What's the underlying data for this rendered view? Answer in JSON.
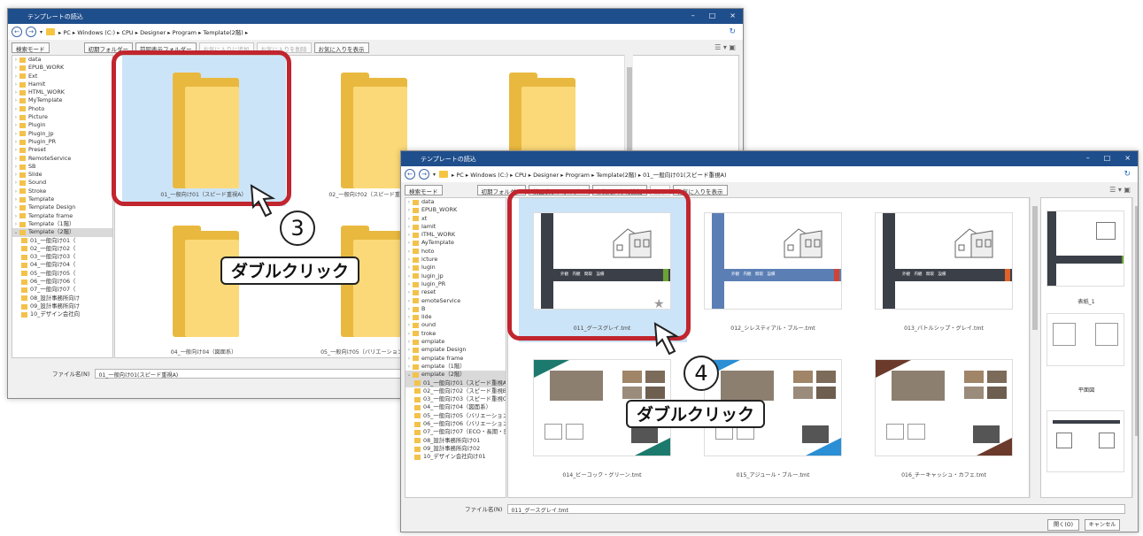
{
  "win1": {
    "title": "テンプレートの読込",
    "breadcrumb": "▸ PC ▸ Windows (C:) ▸ CPU ▸ Designer ▸ Program ▸ Template(2階) ▸",
    "toolbar": {
      "search_mode": "検索モード",
      "initial": "初期フォルダー",
      "prev": "前回表示フォルダー",
      "add_fav": "お気に入りに追加",
      "del_fav": "お気に入りを削除",
      "show_fav": "お気に入りを表示"
    },
    "tree": [
      "data",
      "EPUB_WORK",
      "Ext",
      "Hamit",
      "HTML_WORK",
      "MyTemplate",
      "Photo",
      "Picture",
      "Plugin",
      "Plugin_jp",
      "Plugin_PR",
      "Preset",
      "RemoteService",
      "SB",
      "Slide",
      "Sound",
      "Stroke",
      "Template",
      "Template Design",
      "Template frame",
      "Template（1階）",
      "Template（2階）"
    ],
    "subtree": [
      "01_一般向け01（",
      "02_一般向け02（",
      "03_一般向け03（",
      "04_一般向け04（",
      "05_一般向け05（",
      "06_一般向け06（",
      "07_一般向け07（",
      "08_設計事務所向け",
      "09_設計事務所向け",
      "10_デザイン会社向"
    ],
    "folders": [
      "01_一般向け01（スピード重視A）",
      "02_一般向け02（スピード重視B）",
      "",
      "04_一般向け04（図面系）",
      "05_一般向け05（バリエーション重視A）"
    ],
    "filename_label": "ファイル名(N)",
    "filename_value": "01_一般向け01(スピード重視A)"
  },
  "win2": {
    "title": "テンプレートの読込",
    "breadcrumb": "▸ PC ▸ Windows (C:) ▸ CPU ▸ Designer ▸ Program ▸ Template(2階) ▸ 01_一般向け01(スピード重視A)",
    "toolbar": {
      "search_mode": "検索モード",
      "initial": "初期フォルダー",
      "prev": "前回表示フォルダー",
      "add_fav": "お気に入りに追加",
      "del_fav": "削除",
      "show_fav": "お気に入りを表示"
    },
    "tree": [
      "data",
      "EPUB_WORK",
      "xt",
      "Iamit",
      "ITML_WORK",
      "AyTemplate",
      "hoto",
      "icture",
      "lugin",
      "lugin_jp",
      "lugin_PR",
      "reset",
      "emoteService",
      "B",
      "lide",
      "ound",
      "troke",
      "emplate",
      "emplate Design",
      "emplate frame",
      "emplate（1階）",
      "emplate（2階）"
    ],
    "subtree": [
      "01_一般向け01（スピード重視A）",
      "02_一般向け02（スピード重視B）",
      "03_一般向け03（スピード重視C）",
      "04_一般向け04（図面系）",
      "05_一般向け05（バリエーション重視A）",
      "06_一般向け06（バリエーション重視B）",
      "07_一般向け07（ECO・長期・日射）",
      "08_設計事務所向け01",
      "09_設計事務所向け02",
      "10_デザイン会社向け01"
    ],
    "files": [
      "011_グースグレイ.tmt",
      "012_シレスティアル・ブルー.tmt",
      "013_バトルシップ・グレイ.tmt",
      "014_ビーコック・グリーン.tmt",
      "015_アジュール・ブルー.tmt",
      "016_チーキャッシュ・カフェ.tmt"
    ],
    "thumb_tags": "外観　内観　間取　設備",
    "preview_labels": [
      "表紙_1",
      "平面図"
    ],
    "filename_label": "ファイル名(N)",
    "filename_value": "011_グースグレイ.tmt",
    "open_button": "開く(O)",
    "cancel_button": "キャンセル"
  },
  "annotations": {
    "step3": "3",
    "step4": "4",
    "callout3": "ダブルクリック",
    "callout4": "ダブルクリック"
  },
  "colors": {
    "titlebar": "#1f4e8c",
    "highlight": "#c1252e",
    "selection": "#cce4f7",
    "folder": "#f5c542"
  }
}
